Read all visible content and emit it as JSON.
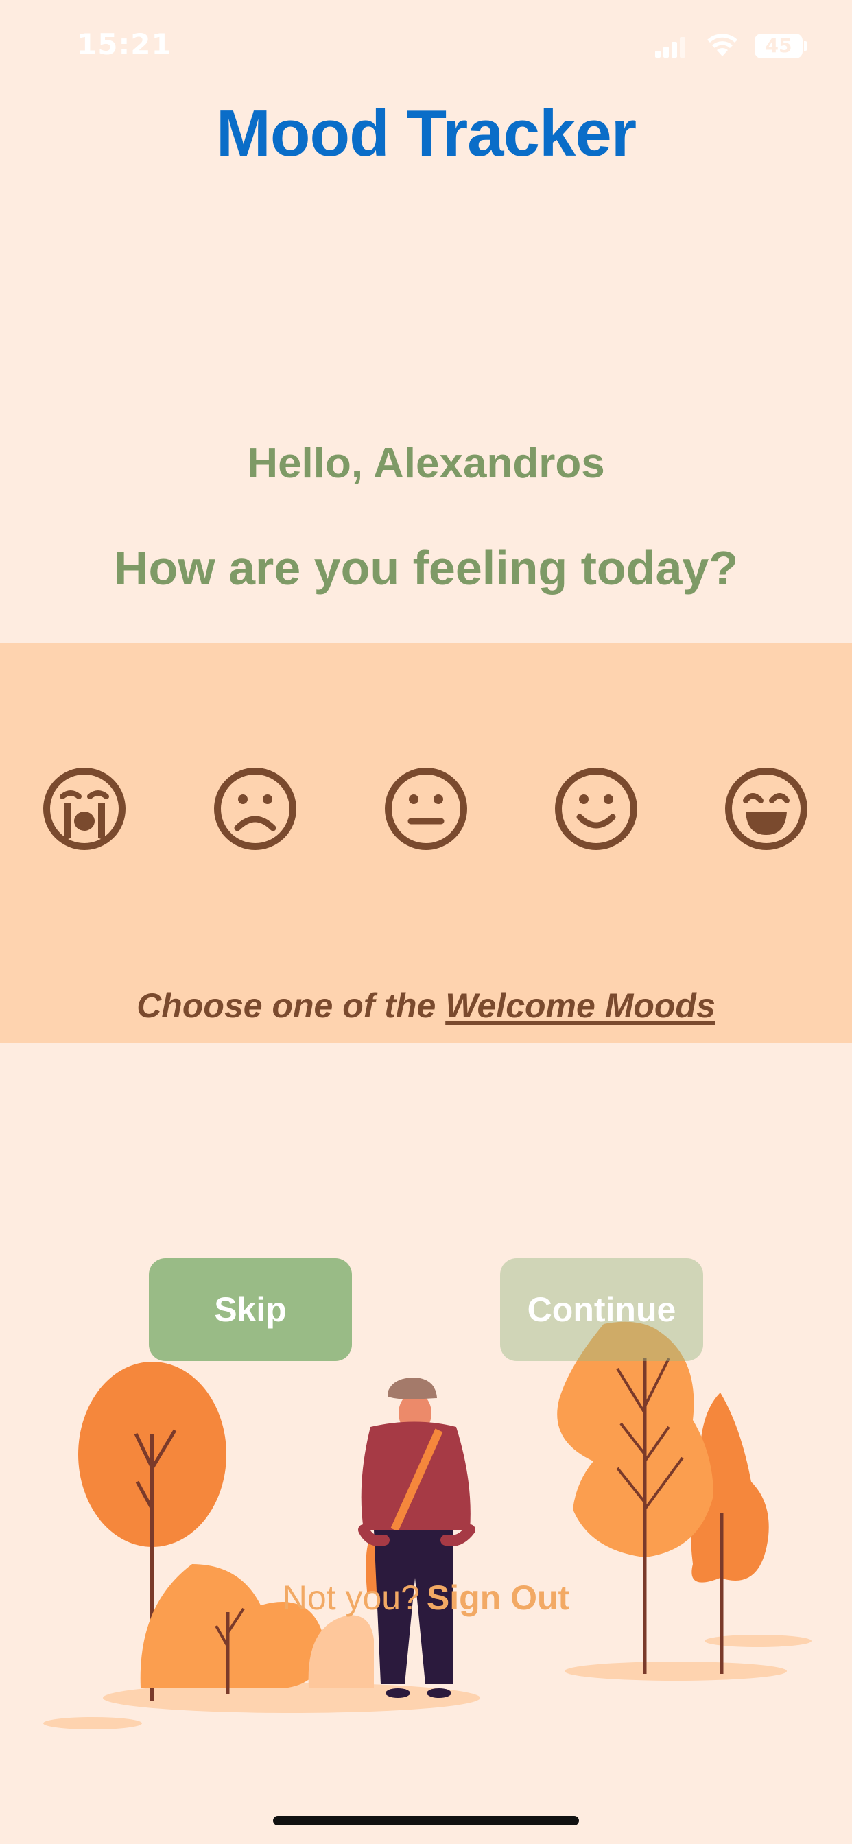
{
  "status_bar": {
    "time": "15:21",
    "battery": "45"
  },
  "app": {
    "title": "Mood Tracker"
  },
  "greeting": {
    "text": "Hello, Alexandros",
    "question": "How are you feeling today?"
  },
  "moods": {
    "items": [
      {
        "name": "crying-face-icon",
        "label": "Very sad"
      },
      {
        "name": "frowning-face-icon",
        "label": "Sad"
      },
      {
        "name": "neutral-face-icon",
        "label": "Neutral"
      },
      {
        "name": "smiling-face-icon",
        "label": "Happy"
      },
      {
        "name": "grinning-face-icon",
        "label": "Very happy"
      }
    ],
    "hint_prefix": "Choose one of the ",
    "hint_link": "Welcome Moods",
    "icon_color": "#7A4A2E"
  },
  "actions": {
    "skip_label": "Skip",
    "continue_label": "Continue"
  },
  "account": {
    "not_you": "Not you?",
    "sign_out": "Sign Out"
  },
  "colors": {
    "background": "#FEECE0",
    "mood_panel": "#FED3AF",
    "title": "#0A6DC8",
    "greeting": "#7E9A66",
    "button": "#99BB86",
    "accent_orange": "#F2A964"
  }
}
